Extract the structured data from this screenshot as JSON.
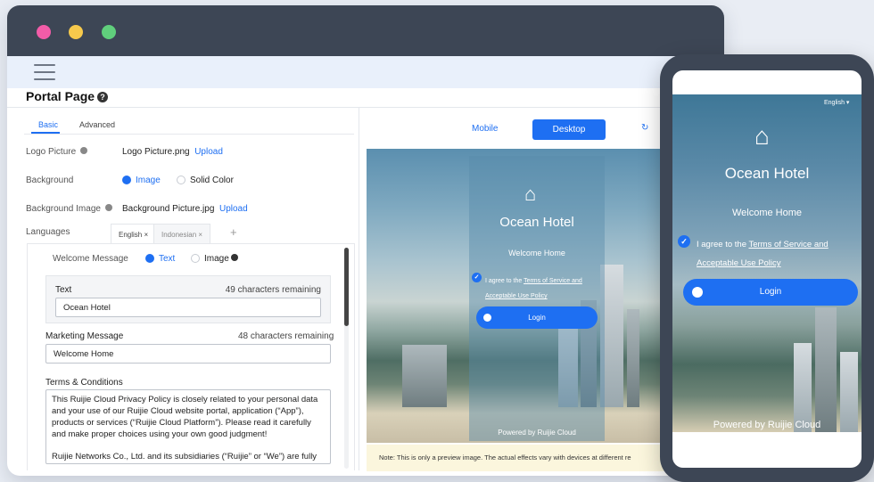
{
  "page": {
    "title": "Portal Page"
  },
  "tabs": [
    "Basic",
    "Advanced"
  ],
  "rows": {
    "logo": {
      "label": "Logo Picture",
      "file": "Logo Picture.png",
      "action": "Upload"
    },
    "background": {
      "label": "Background",
      "option_image": "Image",
      "option_solid": "Solid Color"
    },
    "background_image": {
      "label": "Background Image",
      "file": "Background Picture.jpg",
      "action": "Upload"
    },
    "languages": {
      "label": "Languages",
      "tabs": [
        "English",
        "Indonesian"
      ],
      "close": "×",
      "add": "+"
    }
  },
  "welcome": {
    "label": "Welcome Message",
    "option_text": "Text",
    "option_image": "Image",
    "text_label": "Text",
    "text_remaining": "49  characters remaining",
    "text_value": "Ocean Hotel"
  },
  "marketing": {
    "label": "Marketing Message",
    "remaining": "48  characters remaining",
    "value": "Welcome Home"
  },
  "terms": {
    "label": "Terms & Conditions",
    "body": "This Ruijie Cloud Privacy Policy is closely related to your personal data and your use of our Ruijie Cloud website portal, application (“App”), products or services (“Ruijie Cloud Platform”). Please read it carefully and make proper choices using your own good judgment!",
    "body2": "Ruijie Networks Co., Ltd. and its subsidiaries (“Ruijie” or “We”) are fully"
  },
  "preview": {
    "mode_mobile": "Mobile",
    "mode_desktop": "Desktop",
    "note": "Note: This is only a preview image. The actual effects vary with devices at different re"
  },
  "portal": {
    "hotel_name": "Ocean Hotel",
    "welcome": "Welcome Home",
    "agree_prefix": "I agree to the ",
    "agree_link1": "Terms of Service and",
    "agree_link2": "Acceptable Use Policy",
    "login": "Login",
    "powered": "Powered by Ruijie Cloud",
    "language": "English"
  },
  "colors": {
    "accent": "#1e6ff2",
    "titlebar": "#3d4655"
  }
}
